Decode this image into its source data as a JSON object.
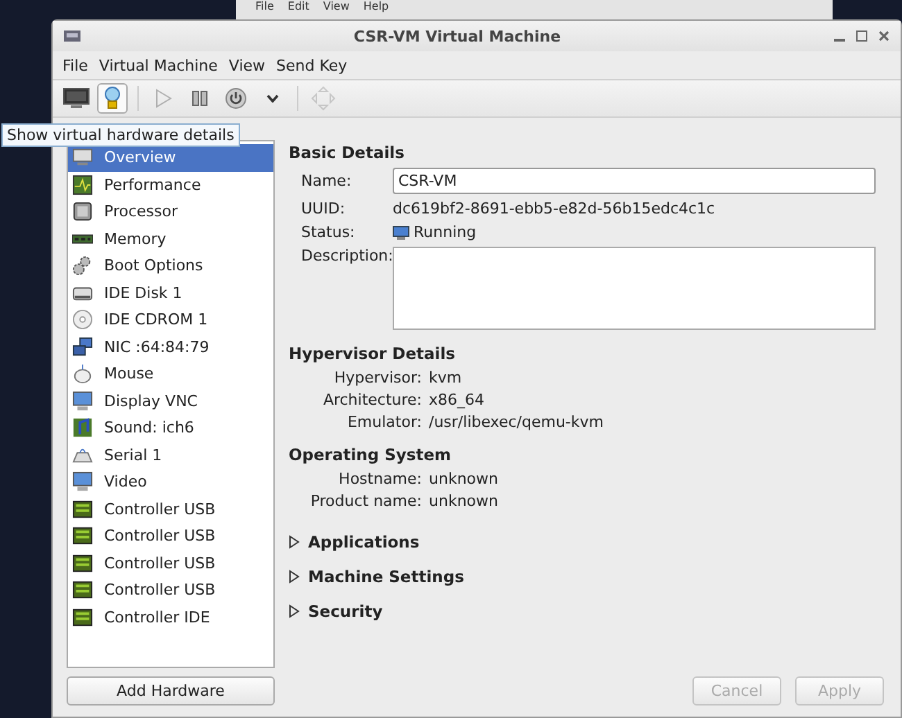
{
  "background_window": {
    "menu": [
      "File",
      "Edit",
      "View",
      "Help"
    ]
  },
  "window": {
    "title": "CSR-VM Virtual Machine"
  },
  "menu_bar": [
    "File",
    "Virtual Machine",
    "View",
    "Send Key"
  ],
  "toolbar": [
    {
      "kind": "console",
      "selected": false,
      "disabled": false
    },
    {
      "kind": "details",
      "selected": true,
      "disabled": false
    },
    {
      "kind": "separator"
    },
    {
      "kind": "run",
      "selected": false,
      "disabled": true
    },
    {
      "kind": "pause",
      "selected": false,
      "disabled": false
    },
    {
      "kind": "power",
      "selected": false,
      "disabled": false
    },
    {
      "kind": "dropdown",
      "selected": false,
      "disabled": false
    },
    {
      "kind": "separator"
    },
    {
      "kind": "fullscreen",
      "selected": false,
      "disabled": true
    }
  ],
  "tooltip": "Show virtual hardware details",
  "sidebar": {
    "items": [
      {
        "kind": "overview",
        "label": "Overview",
        "selected": true
      },
      {
        "kind": "performance",
        "label": "Performance",
        "selected": false
      },
      {
        "kind": "processor",
        "label": "Processor",
        "selected": false
      },
      {
        "kind": "memory",
        "label": "Memory",
        "selected": false
      },
      {
        "kind": "boot",
        "label": "Boot Options",
        "selected": false
      },
      {
        "kind": "disk",
        "label": "IDE Disk 1",
        "selected": false
      },
      {
        "kind": "cdrom",
        "label": "IDE CDROM 1",
        "selected": false
      },
      {
        "kind": "nic",
        "label": "NIC :64:84:79",
        "selected": false
      },
      {
        "kind": "mouse",
        "label": "Mouse",
        "selected": false
      },
      {
        "kind": "display",
        "label": "Display VNC",
        "selected": false
      },
      {
        "kind": "sound",
        "label": "Sound: ich6",
        "selected": false
      },
      {
        "kind": "serial",
        "label": "Serial 1",
        "selected": false
      },
      {
        "kind": "display",
        "label": "Video",
        "selected": false
      },
      {
        "kind": "controller",
        "label": "Controller USB",
        "selected": false
      },
      {
        "kind": "controller",
        "label": "Controller USB",
        "selected": false
      },
      {
        "kind": "controller",
        "label": "Controller USB",
        "selected": false
      },
      {
        "kind": "controller",
        "label": "Controller USB",
        "selected": false
      },
      {
        "kind": "controller",
        "label": "Controller IDE",
        "selected": false
      }
    ],
    "add_button": "Add Hardware"
  },
  "basic_details": {
    "heading": "Basic Details",
    "name_label": "Name:",
    "name_value": "CSR-VM",
    "uuid_label": "UUID:",
    "uuid": "dc619bf2-8691-ebb5-e82d-56b15edc4c1c",
    "status_label": "Status:",
    "status": "Running",
    "description_label": "Description:"
  },
  "hypervisor_details": {
    "heading": "Hypervisor Details",
    "rows": [
      {
        "label": "Hypervisor:",
        "value": "kvm"
      },
      {
        "label": "Architecture:",
        "value": "x86_64"
      },
      {
        "label": "Emulator:",
        "value": "/usr/libexec/qemu-kvm"
      }
    ]
  },
  "operating_system": {
    "heading": "Operating System",
    "rows": [
      {
        "label": "Hostname:",
        "value": "unknown"
      },
      {
        "label": "Product name:",
        "value": "unknown"
      }
    ]
  },
  "expanders": [
    {
      "label": "Applications",
      "expanded": false
    },
    {
      "label": "Machine Settings",
      "expanded": false
    },
    {
      "label": "Security",
      "expanded": false
    }
  ],
  "buttons": [
    {
      "label": "Cancel",
      "disabled": true
    },
    {
      "label": "Apply",
      "disabled": true
    }
  ]
}
